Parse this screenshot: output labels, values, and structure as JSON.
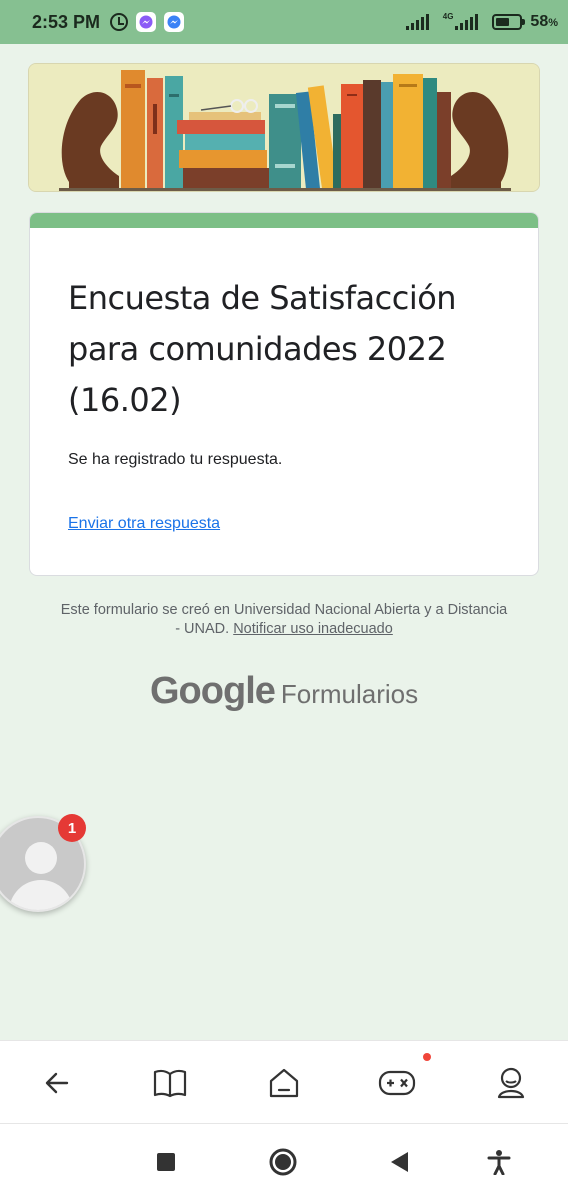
{
  "status_bar": {
    "time": "2:53 PM",
    "icons": [
      "alarm-icon",
      "messenger-icon",
      "messenger-icon"
    ],
    "network_label": "4G",
    "battery_percent": 58,
    "battery_text": "58",
    "battery_unit": "%"
  },
  "form": {
    "title": "Encuesta de Satisfacción para comunidades 2022 (16.02)",
    "confirmation": "Se ha registrado tu respuesta.",
    "resubmit_link": "Enviar otra respuesta",
    "accent_color": "#7cbf86"
  },
  "footer": {
    "created_text": "Este formulario se creó en Universidad Nacional Abierta y a Distancia - UNAD.",
    "report_link": "Notificar uso inadecuado",
    "logo_google": "Google",
    "logo_product": "Formularios"
  },
  "chat_head": {
    "badge_count": "1"
  },
  "app_nav": {
    "items": [
      "back-icon",
      "book-icon",
      "home-icon",
      "gamepad-icon",
      "profile-icon"
    ]
  },
  "system_nav": {
    "items": [
      "recents-square-icon",
      "home-circle-icon",
      "back-triangle-icon",
      "accessibility-icon"
    ]
  },
  "colors": {
    "status_bar": "#86c091",
    "page_background": "#eaf3ea",
    "link": "#1a73e8",
    "badge": "#e53935"
  }
}
